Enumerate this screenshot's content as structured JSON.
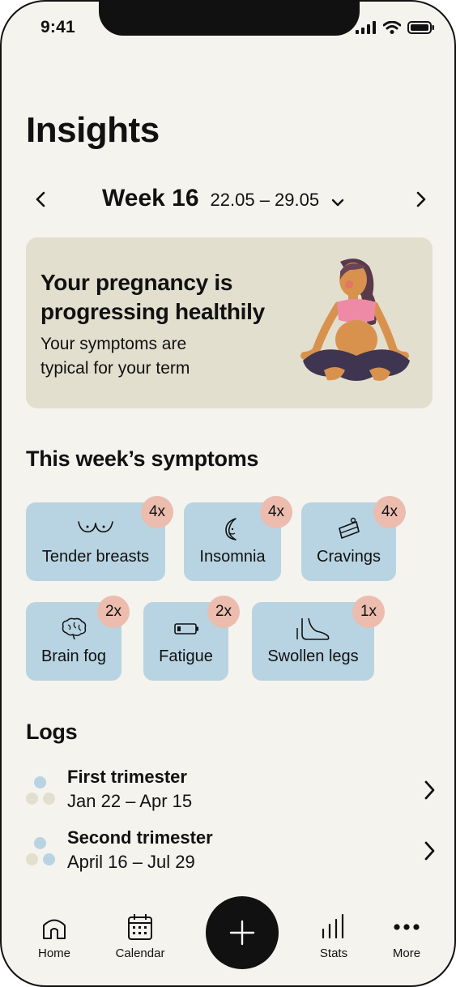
{
  "status_bar": {
    "time": "9:41"
  },
  "page": {
    "title": "Insights"
  },
  "week": {
    "label": "Week 16",
    "range": "22.05 – 29.05"
  },
  "banner": {
    "title": "Your pregnancy is progressing healthily",
    "subtitle": "Your symptoms are typical for your term"
  },
  "symptoms": {
    "heading": "This week’s symptoms",
    "items": [
      {
        "label": "Tender breasts",
        "count": "4x",
        "icon": "breasts-icon"
      },
      {
        "label": "Insomnia",
        "count": "4x",
        "icon": "moon-icon"
      },
      {
        "label": "Cravings",
        "count": "4x",
        "icon": "cake-slice-icon"
      },
      {
        "label": "Brain fog",
        "count": "2x",
        "icon": "brain-icon"
      },
      {
        "label": "Fatigue",
        "count": "2x",
        "icon": "low-battery-icon"
      },
      {
        "label": "Swollen legs",
        "count": "1x",
        "icon": "foot-icon"
      }
    ]
  },
  "logs": {
    "heading": "Logs",
    "items": [
      {
        "title": "First trimester",
        "dates": "Jan 22 – Apr 15"
      },
      {
        "title": "Second trimester",
        "dates": "April 16 – Jul 29"
      }
    ]
  },
  "tabs": [
    {
      "label": "Home",
      "icon": "home-icon"
    },
    {
      "label": "Calendar",
      "icon": "calendar-icon"
    },
    {
      "label": "",
      "icon": "plus-icon"
    },
    {
      "label": "Stats",
      "icon": "bar-chart-icon"
    },
    {
      "label": "More",
      "icon": "more-dots-icon"
    }
  ],
  "colors": {
    "background": "#f5f3ee",
    "banner": "#e2dfcf",
    "chip": "#b8d4e2",
    "badge": "#ecbcae",
    "dot_blue": "#b8d4e2",
    "dot_beige": "#e2dfcf",
    "fab": "#111111"
  }
}
